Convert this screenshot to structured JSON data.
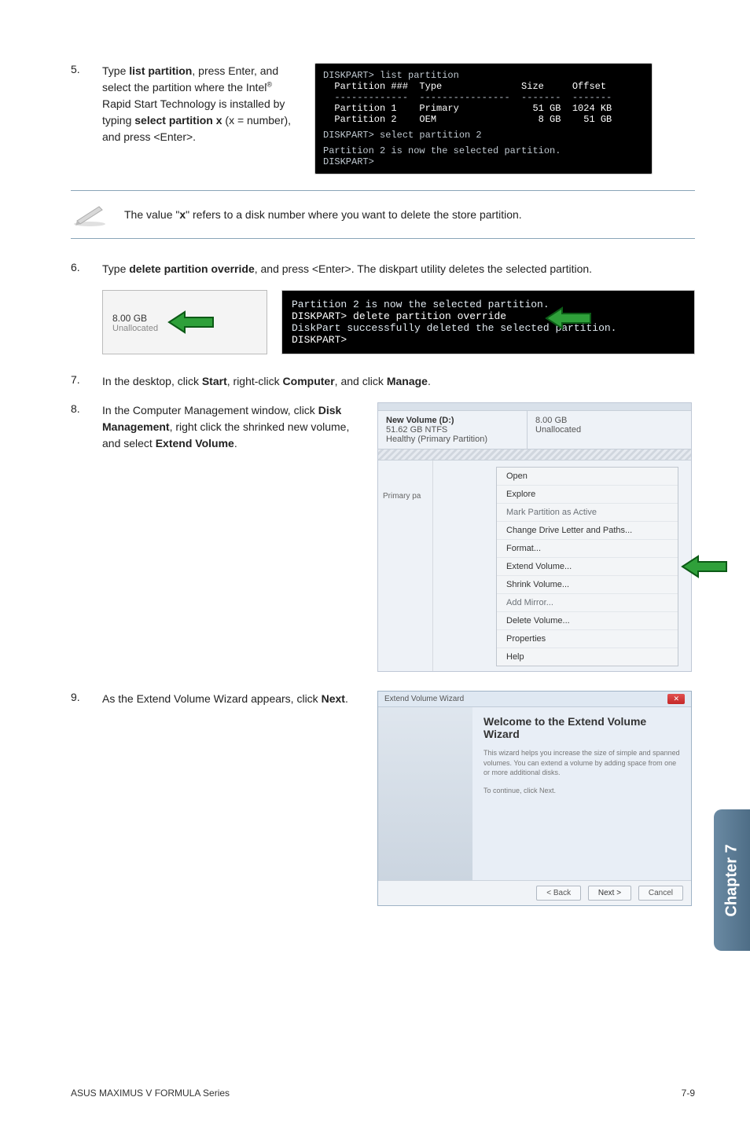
{
  "steps": {
    "s5": {
      "num": "5.",
      "text_a": "Type ",
      "b1": "list partition",
      "text_b": ", press Enter, and select the partition where the Intel",
      "sup": "®",
      "text_c": " Rapid Start Technology is installed by typing ",
      "b2": "select partition x ",
      "text_d": "(x = number),  and press <Enter>."
    },
    "s6": {
      "num": "6.",
      "text_a": "Type ",
      "b1": "delete partition override",
      "text_b": ", and press <Enter>. The diskpart utility deletes the selected partition."
    },
    "s7": {
      "num": "7.",
      "text_a": "In the desktop, click ",
      "b1": "Start",
      "text_b": ", right-click ",
      "b2": "Computer",
      "text_c": ", and click ",
      "b3": "Manage",
      "text_d": "."
    },
    "s8": {
      "num": "8.",
      "text_a": "In the Computer Management window, click ",
      "b1": "Disk Management",
      "text_b": ", right click the shrinked new volume, and select ",
      "b2": "Extend Volume",
      "text_c": "."
    },
    "s9": {
      "num": "9.",
      "text_a": "As the Extend Volume Wizard appears, click ",
      "b1": "Next",
      "text_b": "."
    }
  },
  "note": {
    "text_a": "The value \"",
    "b": "x",
    "text_b": "\" refers to a disk number where you want to delete the store partition."
  },
  "console1": {
    "l1": "DISKPART> list partition",
    "header": "  Partition ###  Type              Size     Offset",
    "hr": "  -------------  ----------------  -------  -------",
    "r1": "  Partition 1    Primary             51 GB  1024 KB",
    "r2": "  Partition 2    OEM                  8 GB    51 GB",
    "l2": "DISKPART> select partition 2",
    "l3": "Partition 2 is now the selected partition.",
    "l4": "DISKPART>"
  },
  "unalloc": {
    "size": "8.00 GB",
    "label": "Unallocated"
  },
  "console2": {
    "l1": "Partition 2 is now the selected partition.",
    "l2": "DISKPART> delete partition override",
    "l3": "DiskPart successfully deleted the selected partition.",
    "l4": "DISKPART>"
  },
  "volbox": {
    "title": "New Volume  (D:)",
    "size": "51.62 GB NTFS",
    "health": "Healthy (Primary Partition)",
    "right_size": "8.00 GB",
    "right_label": "Unallocated",
    "side": "Primary pa"
  },
  "menu": {
    "open": "Open",
    "explore": "Explore",
    "mark": "Mark Partition as Active",
    "change": "Change Drive Letter and Paths...",
    "format": "Format...",
    "extend": "Extend Volume...",
    "shrink": "Shrink Volume...",
    "addmirror": "Add Mirror...",
    "delete": "Delete Volume...",
    "properties": "Properties",
    "help": "Help"
  },
  "wizard": {
    "titlebar": "Extend Volume Wizard",
    "heading": "Welcome to the Extend Volume Wizard",
    "p1": "This wizard helps you increase the size of simple and spanned volumes. You can extend a volume by adding space from one or more additional disks.",
    "p2": "To continue, click Next.",
    "back": "< Back",
    "next": "Next >",
    "cancel": "Cancel"
  },
  "chapter": "Chapter 7",
  "footer": {
    "left": "ASUS MAXIMUS V FORMULA Series",
    "right": "7-9"
  }
}
